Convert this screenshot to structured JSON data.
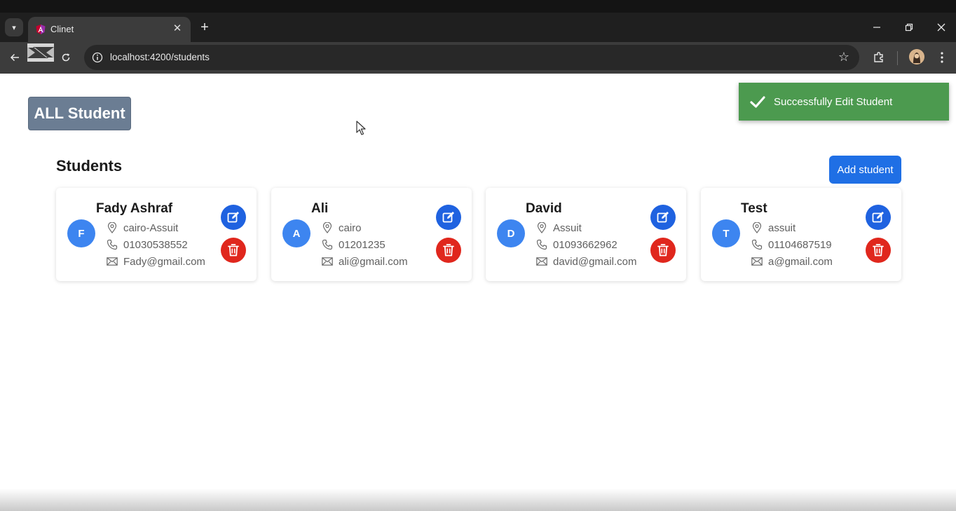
{
  "browser": {
    "tab_title": "Clinet",
    "url": "localhost:4200/students"
  },
  "page": {
    "all_student_label": "ALL Student",
    "section_title": "Students",
    "add_button_label": "Add student"
  },
  "toast": {
    "message": "Successfully Edit Student",
    "color": "#4c9a4f"
  },
  "colors": {
    "avatar": "#3d85f0",
    "edit": "#1f62e0",
    "delete": "#e0271d",
    "add_button": "#1f6fe5"
  },
  "students": [
    {
      "initial": "F",
      "name": "Fady Ashraf",
      "address": "cairo-Assuit",
      "phone": "01030538552",
      "email": "Fady@gmail.com"
    },
    {
      "initial": "A",
      "name": "Ali",
      "address": "cairo",
      "phone": "01201235",
      "email": "ali@gmail.com"
    },
    {
      "initial": "D",
      "name": "David",
      "address": "Assuit",
      "phone": "01093662962",
      "email": "david@gmail.com"
    },
    {
      "initial": "T",
      "name": "Test",
      "address": "assuit",
      "phone": "01104687519",
      "email": "a@gmail.com"
    }
  ]
}
